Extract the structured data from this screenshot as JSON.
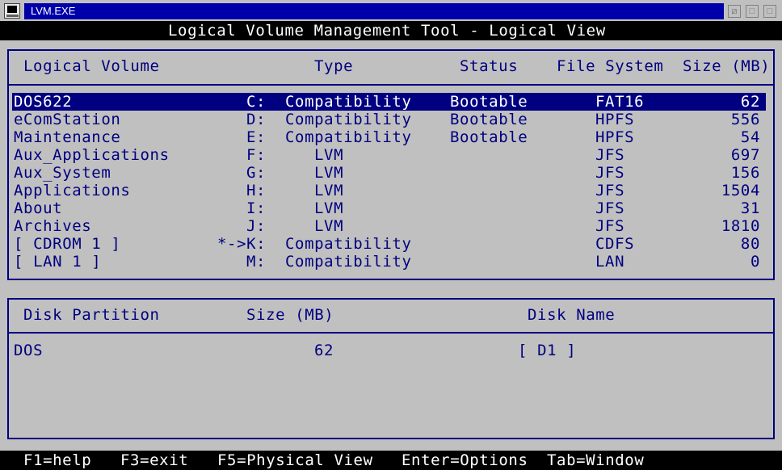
{
  "window": {
    "title": "LVM.EXE",
    "buttons": [
      "⧄",
      "□",
      "□"
    ]
  },
  "header": {
    "title": "Logical Volume Management Tool - Logical View"
  },
  "volumes": {
    "columns": [
      "Logical Volume",
      "Type",
      "Status",
      "File System",
      "Size (MB)"
    ],
    "rows": [
      {
        "name": "DOS622",
        "drive": "C:",
        "type": "Compatibility",
        "status": "Bootable",
        "fs": "FAT16",
        "size": "62",
        "selected": true
      },
      {
        "name": "eComStation",
        "drive": "D:",
        "type": "Compatibility",
        "status": "Bootable",
        "fs": "HPFS",
        "size": "556"
      },
      {
        "name": "Maintenance",
        "drive": "E:",
        "type": "Compatibility",
        "status": "Bootable",
        "fs": "HPFS",
        "size": "54"
      },
      {
        "name": "Aux_Applications",
        "drive": "F:",
        "type": "LVM",
        "status": "",
        "fs": "JFS",
        "size": "697"
      },
      {
        "name": "Aux_System",
        "drive": "G:",
        "type": "LVM",
        "status": "",
        "fs": "JFS",
        "size": "156"
      },
      {
        "name": "Applications",
        "drive": "H:",
        "type": "LVM",
        "status": "",
        "fs": "JFS",
        "size": "1504"
      },
      {
        "name": "About",
        "drive": "I:",
        "type": "LVM",
        "status": "",
        "fs": "JFS",
        "size": "31"
      },
      {
        "name": "Archives",
        "drive": "J:",
        "type": "LVM",
        "status": "",
        "fs": "JFS",
        "size": "1810"
      },
      {
        "name": "[ CDROM 1 ]",
        "drive": "*->K:",
        "type": "Compatibility",
        "status": "",
        "fs": "CDFS",
        "size": "80"
      },
      {
        "name": "[ LAN 1 ]",
        "drive": "M:",
        "type": "Compatibility",
        "status": "",
        "fs": "LAN",
        "size": "0"
      }
    ]
  },
  "partitions": {
    "columns": [
      "Disk Partition",
      "Size (MB)",
      "Disk Name"
    ],
    "rows": [
      {
        "name": "DOS",
        "size": "62",
        "disk": "[ D1 ]"
      }
    ]
  },
  "footer": {
    "keys": [
      "F1=help",
      "F3=exit",
      "F5=Physical View",
      "Enter=Options",
      "Tab=Window"
    ]
  },
  "colors": {
    "titlebar": "#0000aa",
    "text": "#000080",
    "background": "#c0c0c0",
    "selection": "#000080"
  }
}
